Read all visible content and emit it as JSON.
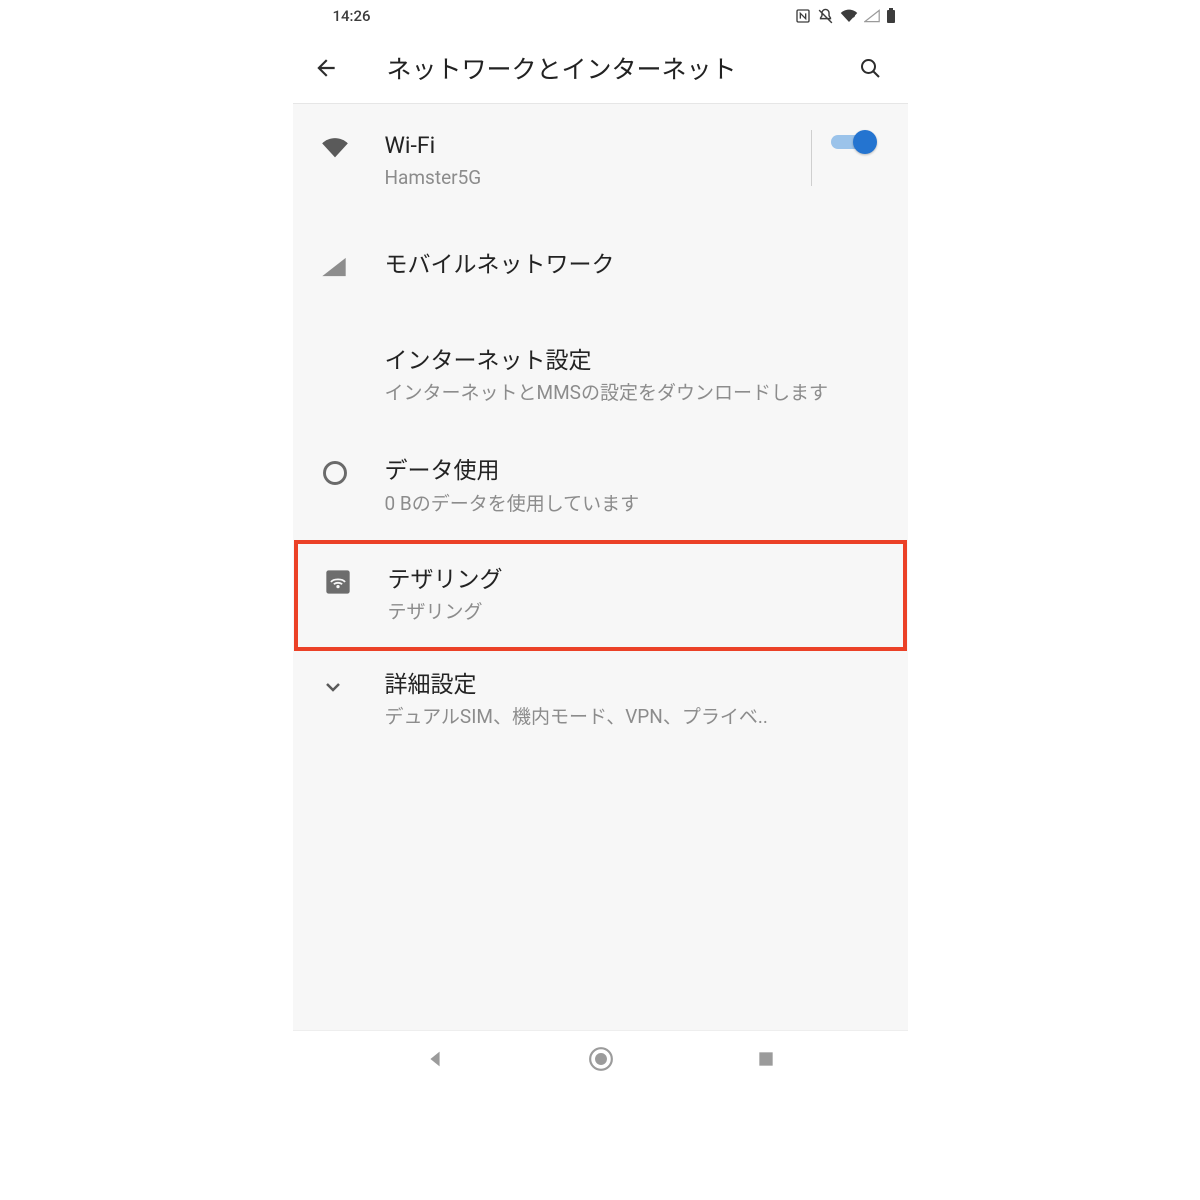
{
  "statusbar": {
    "time": "14:26"
  },
  "appbar": {
    "title": "ネットワークとインターネット"
  },
  "items": {
    "wifi": {
      "title": "Wi-Fi",
      "subtitle": "Hamster5G",
      "toggle_on": true
    },
    "mobile": {
      "title": "モバイルネットワーク"
    },
    "internet": {
      "title": "インターネット設定",
      "subtitle": "インターネットとMMSの設定をダウンロードします"
    },
    "datausage": {
      "title": "データ使用",
      "subtitle": "0 Bのデータを使用しています"
    },
    "tethering": {
      "title": "テザリング",
      "subtitle": "テザリング"
    },
    "advanced": {
      "title": "詳細設定",
      "subtitle": "デュアルSIM、機内モード、VPN、プライベ.."
    }
  }
}
